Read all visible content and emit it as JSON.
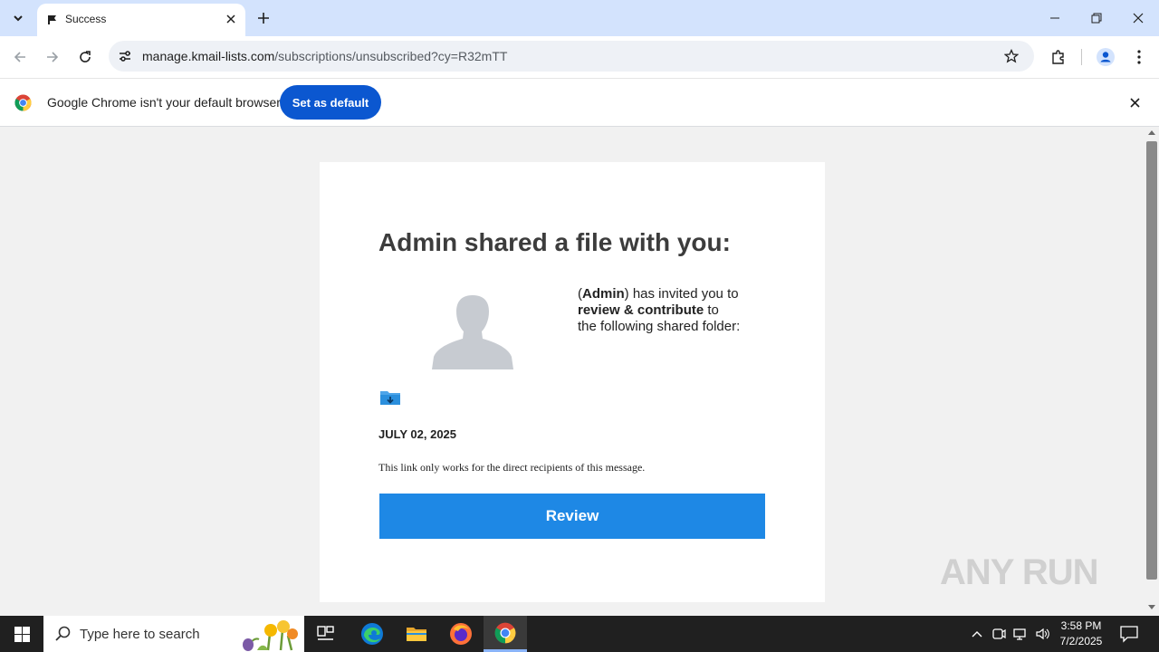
{
  "browser": {
    "tab": {
      "title": "Success",
      "favicon": "flag-icon"
    },
    "address_bar": {
      "host": "manage.kmail-lists.com",
      "path": "/subscriptions/unsubscribed?cy=R32mTT"
    },
    "infobar": {
      "message": "Google Chrome isn't your default browser",
      "button_label": "Set as default"
    }
  },
  "page": {
    "title": "Admin shared a file with you:",
    "invite": {
      "open_paren": "(",
      "sender": "Admin",
      "after_sender": ") has invited you to",
      "action": "review & contribute",
      "after_action": " to",
      "line3": "the following shared folder:"
    },
    "date": "JULY 02, 2025",
    "note": "This link only works for the direct recipients of this message.",
    "button_label": "Review",
    "accent_color": "#1e88e5"
  },
  "watermark": "ANY RUN",
  "taskbar": {
    "search_placeholder": "Type here to search",
    "clock_time": "3:58 PM",
    "clock_date": "7/2/2025"
  }
}
